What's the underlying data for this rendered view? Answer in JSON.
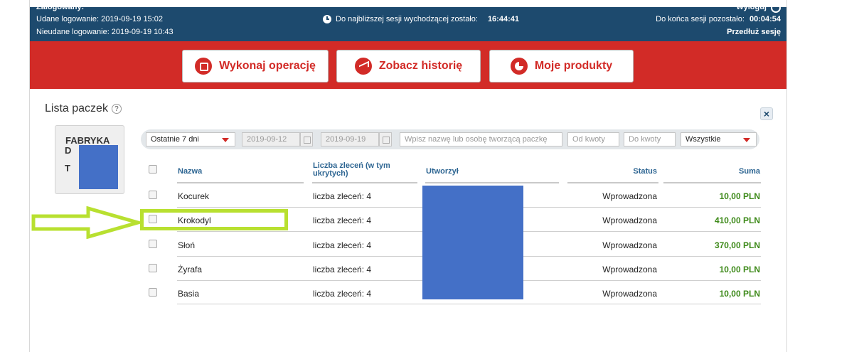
{
  "header": {
    "logged_in_cut": "Zalogowany: ",
    "logout_cut": "Wyloguj",
    "last_success_login": "Udane logowanie: 2019-09-19 15:02",
    "last_failed_login": "Nieudane logowanie: 2019-09-19 10:43",
    "outgoing_session_label": "Do najbliższej sesji wychodzącej zostało:",
    "outgoing_session_value": "16:44:41",
    "session_end_label": "Do końca sesji pozostało:",
    "session_end_value": "00:04:54",
    "extend_session": "Przedłuż sesję"
  },
  "nav": {
    "execute": "Wykonaj operację",
    "history": "Zobacz historię",
    "products": "Moje produkty"
  },
  "section": {
    "title": "Lista paczek",
    "help": "?",
    "close": "×"
  },
  "tile": {
    "line1": "FABRYKA",
    "line2": "D",
    "line3": "T"
  },
  "filters": {
    "period": "Ostatnie 7 dni",
    "date_from": "2019-09-12",
    "date_to": "2019-09-19",
    "search_placeholder": "Wpisz nazwę lub osobę tworzącą paczkę",
    "amount_from_placeholder": "Od kwoty",
    "amount_to_placeholder": "Do kwoty",
    "status": "Wszystkie"
  },
  "table": {
    "headers": {
      "name": "Nazwa",
      "count": "Liczba zleceń (w tym ukrytych)",
      "created_by": "Utworzył",
      "status": "Status",
      "sum": "Suma"
    },
    "rows": [
      {
        "name": "Kocurek",
        "count": "liczba zleceń: 4",
        "status": "Wprowadzona",
        "sum": "10,00 PLN"
      },
      {
        "name": "Krokodyl",
        "count": "liczba zleceń: 4",
        "status": "Wprowadzona",
        "sum": "410,00 PLN"
      },
      {
        "name": "Słoń",
        "count": "liczba zleceń: 4",
        "status": "Wprowadzona",
        "sum": "370,00 PLN"
      },
      {
        "name": "Żyrafa",
        "count": "liczba zleceń: 4",
        "status": "Wprowadzona",
        "sum": "10,00 PLN"
      },
      {
        "name": "Basia",
        "count": "liczba zleceń: 4",
        "status": "Wprowadzona",
        "sum": "10,00 PLN"
      }
    ]
  },
  "colors": {
    "header_bg": "#1d4a6e",
    "brand_red": "#d22b27",
    "sum_green": "#3e8a1a",
    "highlight": "#b8e030",
    "redaction": "#4470c7"
  }
}
